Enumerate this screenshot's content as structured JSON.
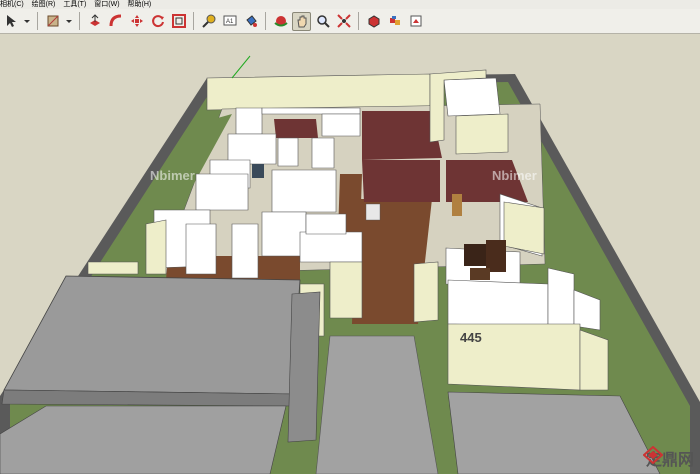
{
  "menu": {
    "items": [
      "相机(C)",
      "绘图(R)",
      "工具(T)",
      "窗口(W)",
      "帮助(H)"
    ]
  },
  "toolbar": {
    "tools": [
      {
        "icon": "select-arrow-icon"
      },
      {
        "icon": "dropdown-icon"
      },
      {
        "icon": "rectangle-icon"
      },
      {
        "icon": "dropdown-icon"
      },
      {
        "icon": "push-pull-icon"
      },
      {
        "icon": "follow-me-icon"
      },
      {
        "icon": "move-icon"
      },
      {
        "icon": "rotate-icon"
      },
      {
        "icon": "offset-icon"
      },
      {
        "icon": "tape-measure-icon"
      },
      {
        "icon": "text-icon"
      },
      {
        "icon": "paint-bucket-icon"
      },
      {
        "icon": "orbit-icon"
      },
      {
        "icon": "pan-icon"
      },
      {
        "icon": "zoom-icon"
      },
      {
        "icon": "zoom-extents-icon"
      },
      {
        "icon": "components-icon"
      },
      {
        "icon": "warehouse-icon"
      },
      {
        "icon": "share-model-icon"
      }
    ]
  },
  "viewport": {
    "room_number": "445",
    "watermark_left": "Nbimer",
    "watermark_right": "Nbimer",
    "badge_text": "定鼎网"
  },
  "colors": {
    "sky": "#d9d6c4",
    "wall_white": "#ffffff",
    "wall_cream": "#eeeeca",
    "floor_wood": "#7a4a2e",
    "floor_maroon": "#6e3434",
    "slab_gray": "#9a9a9a",
    "grass": "#6f8a4e",
    "ground_outline": "#5a5a5a"
  }
}
